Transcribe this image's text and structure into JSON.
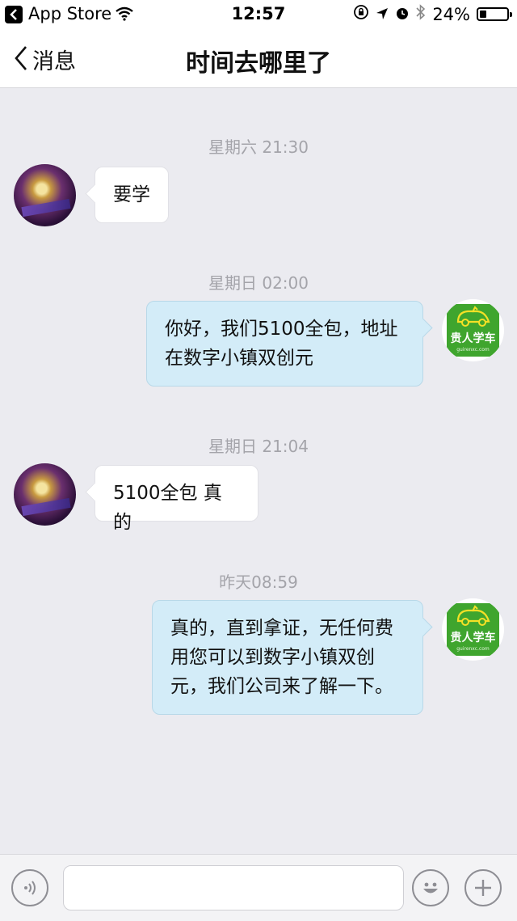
{
  "status_bar": {
    "back_app": "App Store",
    "time": "12:57",
    "battery": "24%",
    "battery_level": 0.24
  },
  "nav": {
    "back_label": "消息",
    "title": "时间去哪里了"
  },
  "messages": [
    {
      "timestamp": "星期六 21:30",
      "side": "left",
      "text": "要学"
    },
    {
      "timestamp": "星期日 02:00",
      "side": "right",
      "text": "你好，我们5100全包，地址在数字小镇双创元"
    },
    {
      "timestamp": "星期日 21:04",
      "side": "left",
      "text": "5100全包 真的"
    },
    {
      "timestamp": "昨天08:59",
      "side": "right",
      "text": "真的，直到拿证，无任何费用您可以到数字小镇双创元，我们公司来了解一下。"
    }
  ],
  "brand_avatar": {
    "text": "贵人学车",
    "sub": "guirenxc.com"
  },
  "input": {
    "value": "",
    "placeholder": ""
  },
  "icons": {
    "voice": "voice-icon",
    "emoji": "emoji-icon",
    "add": "plus-icon",
    "back": "chevron-left-icon",
    "wifi": "wifi-icon"
  }
}
